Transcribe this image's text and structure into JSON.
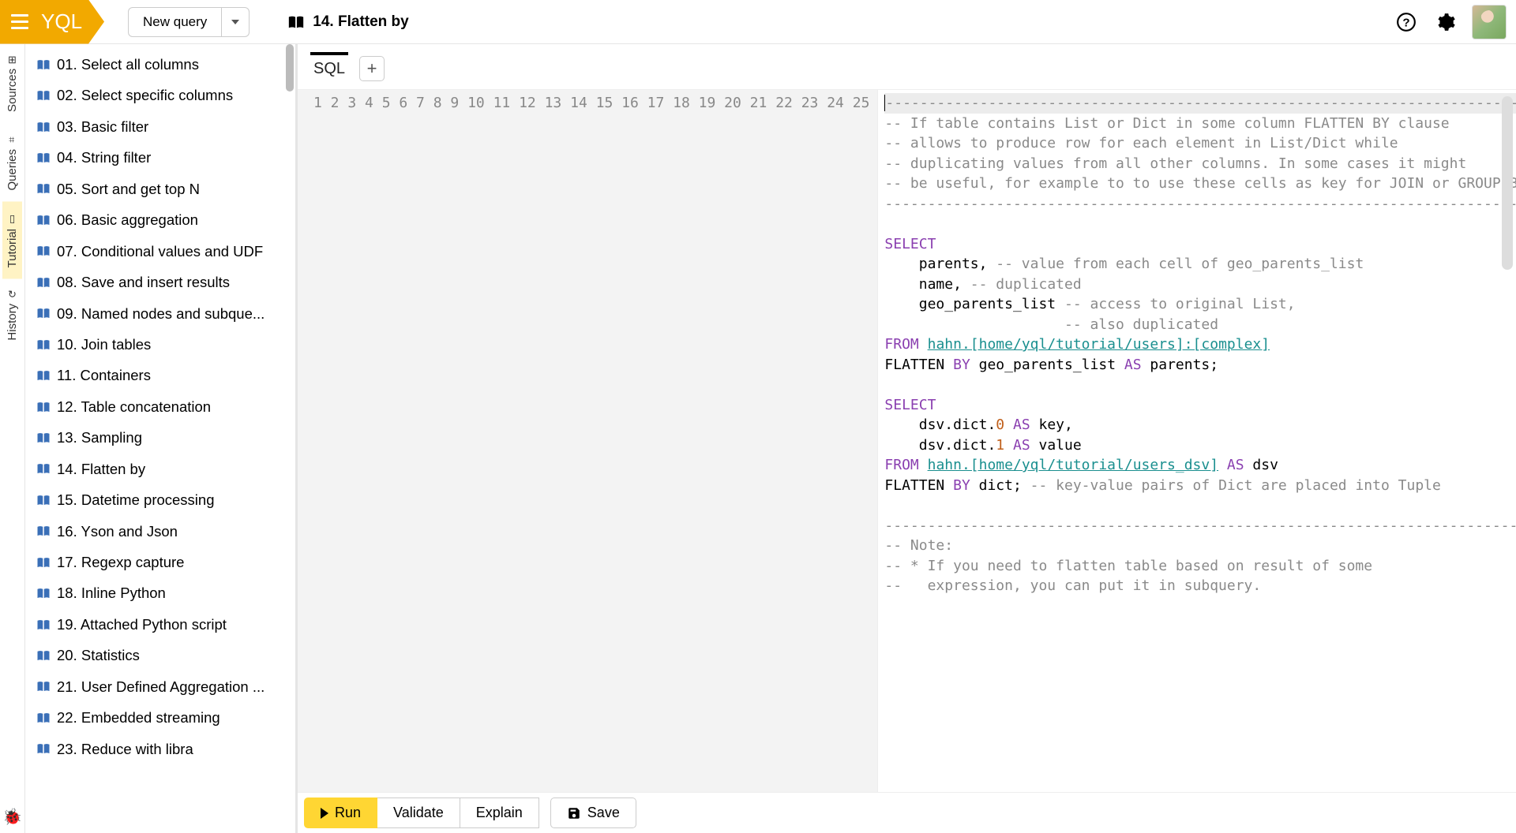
{
  "header": {
    "logo": "YQL",
    "new_query": "New query",
    "page_title": "14. Flatten by"
  },
  "side_tabs": [
    {
      "label": "Sources",
      "icon": "⊞"
    },
    {
      "label": "Queries",
      "icon": "⌗"
    },
    {
      "label": "Tutorial",
      "icon": "▭",
      "active": true
    },
    {
      "label": "History",
      "icon": "↻"
    }
  ],
  "tutorial_items": [
    "01. Select all columns",
    "02. Select specific columns",
    "03. Basic filter",
    "04. String filter",
    "05. Sort and get top N",
    "06. Basic aggregation",
    "07. Conditional values and UDF",
    "08. Save and insert results",
    "09. Named nodes and subque...",
    "10. Join tables",
    "11. Containers",
    "12. Table concatenation",
    "13. Sampling",
    "14. Flatten by",
    "15. Datetime processing",
    "16. Yson and Json",
    "17. Regexp capture",
    "18. Inline Python",
    "19. Attached Python script",
    "20. Statistics",
    "21. User Defined Aggregation ...",
    "22. Embedded streaming",
    "23. Reduce with libra"
  ],
  "editor": {
    "tab_label": "SQL",
    "line_count": 25,
    "lines": {
      "l1": "--------------------------------------------------------------------------------",
      "l2_a": "-- If table contains List or Dict in some column FLATTEN BY clause",
      "l3_a": "-- allows to produce row for each element in List/Dict while",
      "l4_a": "-- duplicating values from all other columns. In some cases it might",
      "l5_a": "-- be useful, for example to to use these cells as key for JOIN or GROUP BY.",
      "l6": "--------------------------------------------------------------------------------",
      "l8_kw": "SELECT",
      "l9_txt": "    parents, ",
      "l9_c": "-- value from each cell of geo_parents_list",
      "l10_txt": "    name, ",
      "l10_c": "-- duplicated",
      "l11_txt": "    geo_parents_list ",
      "l11_c": "-- access to original List,",
      "l12_sp": "                     ",
      "l12_c": "-- also duplicated",
      "l13_kw": "FROM",
      "l13_link": "hahn.[home/yql/tutorial/users]:[complex]",
      "l14_a": "FLATTEN ",
      "l14_kw": "BY",
      "l14_b": " geo_parents_list ",
      "l14_kw2": "AS",
      "l14_c": " parents;",
      "l16_kw": "SELECT",
      "l17_a": "    dsv.dict.",
      "l17_n": "0",
      "l17_kw": " AS",
      "l17_b": " key,",
      "l18_a": "    dsv.dict.",
      "l18_n": "1",
      "l18_kw": " AS",
      "l18_b": " value",
      "l19_kw": "FROM",
      "l19_link": "hahn.[home/yql/tutorial/users_dsv]",
      "l19_kw2": " AS",
      "l19_b": " dsv",
      "l20_a": "FLATTEN ",
      "l20_kw": "BY",
      "l20_b": " dict; ",
      "l20_c": "-- key-value pairs of Dict are placed into Tuple",
      "l22": "--------------------------------------------------------------------------------",
      "l23": "-- Note:",
      "l24": "-- * If you need to flatten table based on result of some",
      "l25": "--   expression, you can put it in subquery."
    }
  },
  "actions": {
    "run": "Run",
    "validate": "Validate",
    "explain": "Explain",
    "save": "Save"
  }
}
